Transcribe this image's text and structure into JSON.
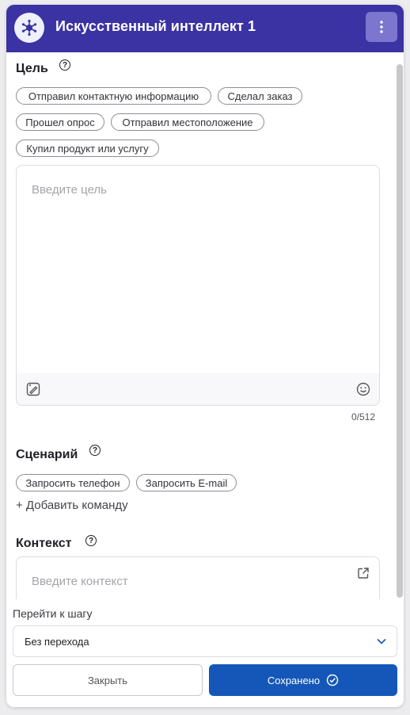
{
  "header": {
    "title": "Искусственный интеллект 1",
    "avatar_icon": "sparkle-network-icon",
    "menu_icon": "vertical-dots-icon",
    "bg_color": "#3b32a3"
  },
  "goal": {
    "title": "Цель",
    "chips": [
      "Отправил контактную информацию",
      "Сделал заказ",
      "Прошел опрос",
      "Отправил местоположение",
      "Купил продукт или услугу"
    ],
    "placeholder": "Введите цель",
    "counter": "0/512"
  },
  "scenario": {
    "title": "Сценарий",
    "chips": [
      "Запросить телефон",
      "Запросить E-mail"
    ],
    "add_command": "+ Добавить команду"
  },
  "context": {
    "title": "Контекст",
    "placeholder": "Введите контекст"
  },
  "goto": {
    "label": "Перейти к шагу",
    "selected": "Без перехода"
  },
  "buttons": {
    "close": "Закрыть",
    "save": "Сохранено",
    "save_color": "#1557b8"
  }
}
